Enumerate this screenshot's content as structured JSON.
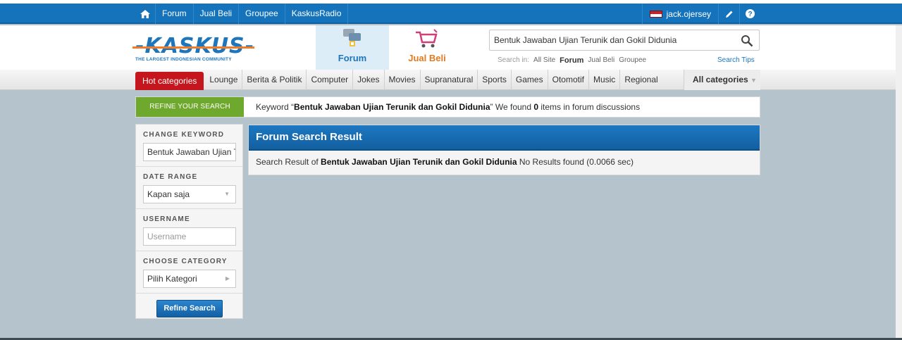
{
  "topnav": {
    "items": [
      "Forum",
      "Jual Beli",
      "Groupee",
      "KaskusRadio"
    ],
    "username": "jack.ojersey"
  },
  "logo": {
    "tagline": "THE LARGEST INDONESIAN COMMUNITY"
  },
  "tabs": {
    "forum": "Forum",
    "jualbeli": "Jual Beli"
  },
  "search": {
    "value": "Bentuk Jawaban Ujian Terunik dan Gokil Didunia",
    "search_in_label": "Search in:",
    "options": [
      "All Site",
      "Forum",
      "Jual Beli",
      "Groupee"
    ],
    "active_option": "Forum",
    "tips": "Search Tips"
  },
  "categories": {
    "hot": "Hot categories",
    "items": [
      "Lounge",
      "Berita & Politik",
      "Computer",
      "Jokes",
      "Movies",
      "Supranatural",
      "Sports",
      "Games",
      "Otomotif",
      "Music",
      "Regional"
    ],
    "all": "All categories"
  },
  "refine_banner": {
    "tab": "REFINE YOUR SEARCH",
    "msg_prefix": "Keyword “",
    "keyword": "Bentuk Jawaban Ujian Terunik dan Gokil Didunia",
    "msg_mid": "” We found ",
    "count": "0",
    "msg_suffix": " items in forum discussions"
  },
  "sidebar": {
    "change_keyword": "CHANGE KEYWORD",
    "keyword_value": "Bentuk Jawaban Ujian Terunik dan Gokil Didunia",
    "date_range": "DATE RANGE",
    "date_value": "Kapan saja",
    "username": "USERNAME",
    "username_placeholder": "Username",
    "choose_category": "CHOOSE CATEGORY",
    "category_value": "Pilih Kategori",
    "refine_button": "Refine Search"
  },
  "result": {
    "title": "Forum Search Result",
    "prefix": "Search Result of ",
    "keyword": "Bentuk Jawaban Ujian Terunik dan Gokil Didunia",
    "suffix": " No Results found (0.0066 sec)"
  },
  "colors": {
    "primary_blue": "#1573bb",
    "hot_red": "#c4161c",
    "refine_green": "#6ea82c",
    "background": "#b4c3cc"
  }
}
